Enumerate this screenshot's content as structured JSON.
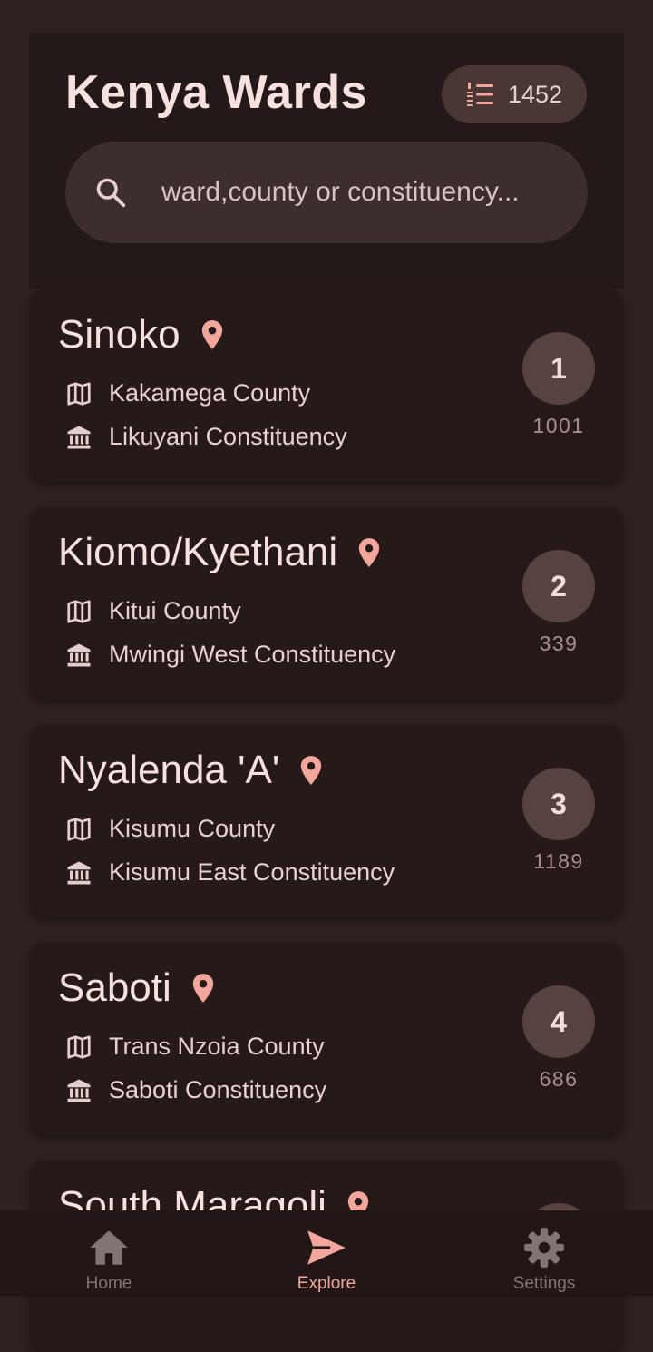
{
  "app": {
    "title": "Kenya Wards"
  },
  "count_chip": {
    "icon": "list-numbered-icon",
    "value": "1452"
  },
  "search": {
    "icon": "search-icon",
    "placeholder": "ward,county or constituency..."
  },
  "colors": {
    "accent": "#f3a79c",
    "background": "#2f2120",
    "card": "#261a19",
    "header": "#231918"
  },
  "wards": [
    {
      "name": "Sinoko",
      "county": "Kakamega County",
      "constituency": "Likuyani Constituency",
      "rank": "1",
      "code": "1001"
    },
    {
      "name": "Kiomo/Kyethani",
      "county": "Kitui County",
      "constituency": "Mwingi West Constituency",
      "rank": "2",
      "code": "339"
    },
    {
      "name": "Nyalenda 'A'",
      "county": "Kisumu County",
      "constituency": "Kisumu East Constituency",
      "rank": "3",
      "code": "1189"
    },
    {
      "name": "Saboti",
      "county": "Trans Nzoia County",
      "constituency": "Saboti Constituency",
      "rank": "4",
      "code": "686"
    },
    {
      "name": "South Maragoli"
    }
  ],
  "nav": [
    {
      "label": "Home",
      "icon": "home-icon",
      "active": false
    },
    {
      "label": "Explore",
      "icon": "send-icon",
      "active": true
    },
    {
      "label": "Settings",
      "icon": "gear-icon",
      "active": false
    }
  ]
}
